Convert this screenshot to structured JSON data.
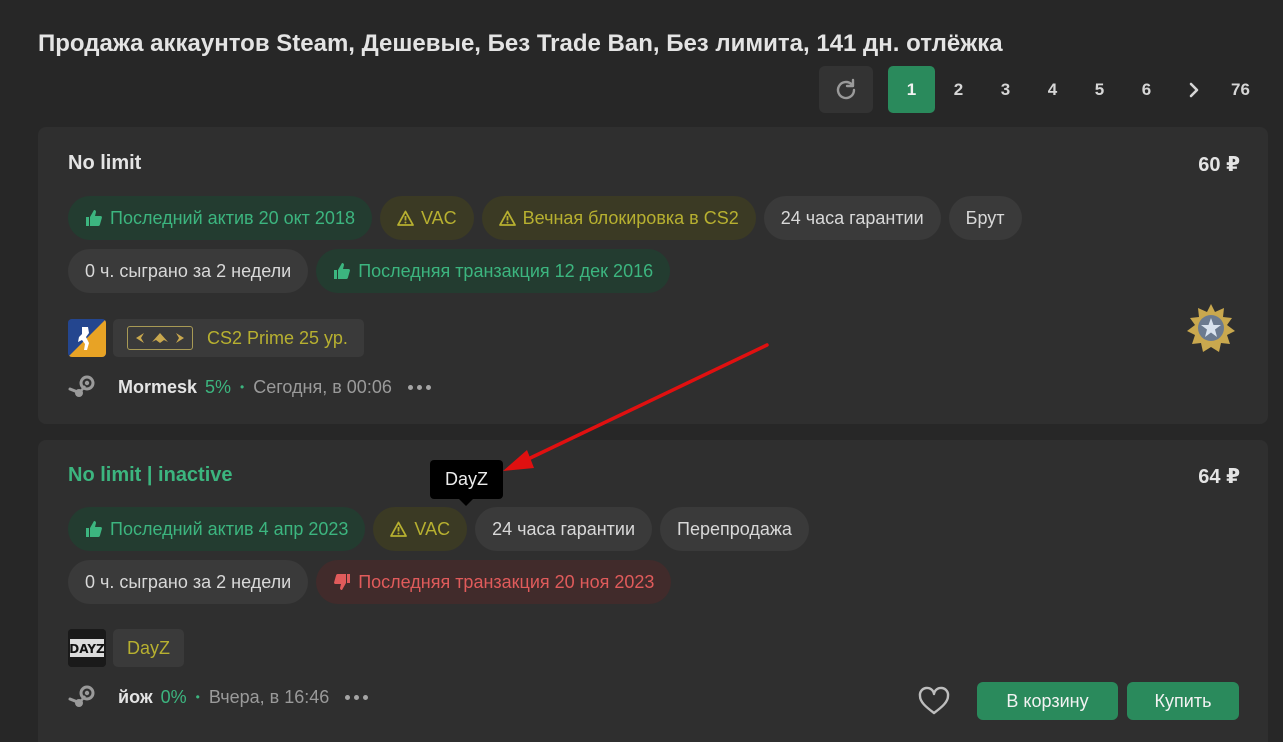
{
  "page": {
    "title": "Продажа аккаунтов Steam, Дешевые, Без Trade Ban, Без лимита, 141 дн. отлёжка"
  },
  "pagination": {
    "pages": [
      "1",
      "2",
      "3",
      "4",
      "5",
      "6"
    ],
    "current": "1",
    "next_icon": "chevron-right-icon",
    "last": "76"
  },
  "listings": [
    {
      "title": "No limit",
      "price": "60 ₽",
      "tags_row1": [
        {
          "text": "Последний актив 20 окт 2018",
          "kind": "green",
          "icon": "thumbs-up-icon"
        },
        {
          "text": "VAC",
          "kind": "yellow",
          "icon": "warning-icon"
        },
        {
          "text": "Вечная блокировка в CS2",
          "kind": "yellow",
          "icon": "warning-icon"
        },
        {
          "text": "24 часа гарантии",
          "kind": "neutral"
        },
        {
          "text": "Брут",
          "kind": "neutral"
        }
      ],
      "tags_row2": [
        {
          "text": "0 ч. сыграно за 2 недели",
          "kind": "neutral"
        },
        {
          "text": "Последняя транзакция 12 дек 2016",
          "kind": "green",
          "icon": "thumbs-up-icon"
        }
      ],
      "game": {
        "name": "CS2 Prime 25 ур.",
        "icon": "cs2-icon"
      },
      "seller": {
        "name": "Mormesk",
        "percent": "5%",
        "time": "Сегодня, в 00:06"
      }
    },
    {
      "title": "No limit | inactive",
      "price": "64 ₽",
      "tags_row1": [
        {
          "text": "Последний актив 4 апр 2023",
          "kind": "green",
          "icon": "thumbs-up-icon"
        },
        {
          "text": "VAC",
          "kind": "yellow",
          "icon": "warning-icon"
        },
        {
          "text": "24 часа гарантии",
          "kind": "neutral"
        },
        {
          "text": "Перепродажа",
          "kind": "neutral"
        }
      ],
      "tags_row2": [
        {
          "text": "0 ч. сыграно за 2 недели",
          "kind": "neutral"
        },
        {
          "text": "Последняя транзакция 20 ноя 2023",
          "kind": "red",
          "icon": "thumbs-down-icon"
        }
      ],
      "game": {
        "name": "DayZ",
        "icon": "dayz-icon",
        "icon_text": "DAYZ"
      },
      "seller": {
        "name": "йож",
        "percent": "0%",
        "time": "Вчера, в 16:46"
      },
      "actions": {
        "cart": "В корзину",
        "buy": "Купить"
      }
    }
  ],
  "tooltip": {
    "text": "DayZ"
  },
  "colors": {
    "background": "#272727",
    "card": "#2f2f2f",
    "accent_green": "#2a8a5c",
    "text_green": "#3cb57f",
    "text_yellow": "#b7b030",
    "text_red": "#e05b5b",
    "annotation_arrow": "#e01010"
  }
}
